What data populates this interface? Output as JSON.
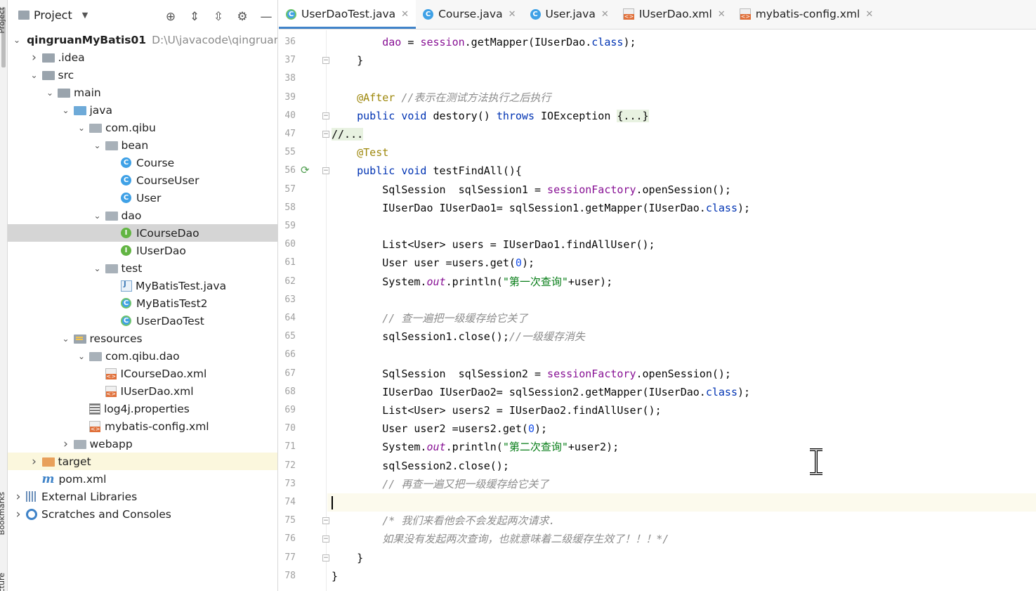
{
  "toolstrip": {
    "top_label": "Project",
    "bookmarks_label": "Bookmarks",
    "structure_label": "Structure"
  },
  "project_panel": {
    "title": "Project",
    "tree": [
      {
        "depth": 0,
        "arrow": "down",
        "icon": "module-folder",
        "label": "qingruanMyBatis01",
        "bold": true,
        "path": "D:\\U\\javacode\\qingruan"
      },
      {
        "depth": 1,
        "arrow": "right",
        "icon": "folder",
        "label": ".idea"
      },
      {
        "depth": 1,
        "arrow": "down",
        "icon": "folder",
        "label": "src"
      },
      {
        "depth": 2,
        "arrow": "down",
        "icon": "folder",
        "label": "main"
      },
      {
        "depth": 3,
        "arrow": "down",
        "icon": "folder-blue",
        "label": "java"
      },
      {
        "depth": 4,
        "arrow": "down",
        "icon": "package",
        "label": "com.qibu"
      },
      {
        "depth": 5,
        "arrow": "down",
        "icon": "package",
        "label": "bean"
      },
      {
        "depth": 6,
        "arrow": "none",
        "icon": "class",
        "label": "Course"
      },
      {
        "depth": 6,
        "arrow": "none",
        "icon": "class",
        "label": "CourseUser"
      },
      {
        "depth": 6,
        "arrow": "none",
        "icon": "class",
        "label": "User"
      },
      {
        "depth": 5,
        "arrow": "down",
        "icon": "package",
        "label": "dao"
      },
      {
        "depth": 6,
        "arrow": "none",
        "icon": "interface",
        "label": "ICourseDao",
        "selected": true
      },
      {
        "depth": 6,
        "arrow": "none",
        "icon": "interface",
        "label": "IUserDao"
      },
      {
        "depth": 5,
        "arrow": "down",
        "icon": "package",
        "label": "test"
      },
      {
        "depth": 6,
        "arrow": "none",
        "icon": "java-file",
        "label": "MyBatisTest.java"
      },
      {
        "depth": 6,
        "arrow": "none",
        "icon": "test-class",
        "label": "MyBatisTest2"
      },
      {
        "depth": 6,
        "arrow": "none",
        "icon": "test-class",
        "label": "UserDaoTest"
      },
      {
        "depth": 3,
        "arrow": "down",
        "icon": "resources-folder",
        "label": "resources"
      },
      {
        "depth": 4,
        "arrow": "down",
        "icon": "package",
        "label": "com.qibu.dao"
      },
      {
        "depth": 5,
        "arrow": "none",
        "icon": "xml",
        "label": "ICourseDao.xml"
      },
      {
        "depth": 5,
        "arrow": "none",
        "icon": "xml",
        "label": "IUserDao.xml"
      },
      {
        "depth": 4,
        "arrow": "none",
        "icon": "properties",
        "label": "log4j.properties"
      },
      {
        "depth": 4,
        "arrow": "none",
        "icon": "xml",
        "label": "mybatis-config.xml"
      },
      {
        "depth": 3,
        "arrow": "right",
        "icon": "webapp-folder",
        "label": "webapp"
      },
      {
        "depth": 1,
        "arrow": "right",
        "icon": "folder-orange",
        "label": "target",
        "excluded": true
      },
      {
        "depth": 1,
        "arrow": "none",
        "icon": "maven",
        "label": "pom.xml"
      },
      {
        "depth": 0,
        "arrow": "right",
        "icon": "libraries",
        "label": "External Libraries"
      },
      {
        "depth": 0,
        "arrow": "right",
        "icon": "scratches",
        "label": "Scratches and Consoles"
      }
    ]
  },
  "editor": {
    "tabs": [
      {
        "label": "UserDaoTest.java",
        "icon": "test-class",
        "active": true
      },
      {
        "label": "Course.java",
        "icon": "class",
        "active": false
      },
      {
        "label": "User.java",
        "icon": "class",
        "active": false
      },
      {
        "label": "IUserDao.xml",
        "icon": "xml",
        "active": false
      },
      {
        "label": "mybatis-config.xml",
        "icon": "xml",
        "active": false
      }
    ],
    "lines": [
      {
        "no": "36",
        "fold": false,
        "segments": [
          [
            "",
            "        "
          ],
          [
            "fld",
            "dao"
          ],
          [
            "",
            " = "
          ],
          [
            "fld",
            "session"
          ],
          [
            "",
            ".getMapper(IUserDao."
          ],
          [
            "kw",
            "class"
          ],
          [
            "",
            ");"
          ]
        ]
      },
      {
        "no": "37",
        "fold": true,
        "segments": [
          [
            "",
            "    }"
          ]
        ]
      },
      {
        "no": "38",
        "fold": false,
        "segments": []
      },
      {
        "no": "39",
        "fold": false,
        "segments": [
          [
            "",
            "    "
          ],
          [
            "ann",
            "@After"
          ],
          [
            "",
            " "
          ],
          [
            "cmt",
            "//表示在测试方法执行之后执行"
          ]
        ]
      },
      {
        "no": "40",
        "fold": true,
        "segments": [
          [
            "",
            "    "
          ],
          [
            "kw",
            "public"
          ],
          [
            "",
            " "
          ],
          [
            "kw",
            "void"
          ],
          [
            "",
            " "
          ],
          [
            "",
            "destory"
          ],
          [
            "",
            "() "
          ],
          [
            "kw",
            "throws"
          ],
          [
            "",
            " IOException "
          ],
          [
            "folded",
            "{...}"
          ]
        ]
      },
      {
        "no": "47",
        "fold": true,
        "segments": [
          [
            "folded",
            "//..."
          ]
        ]
      },
      {
        "no": "55",
        "fold": false,
        "segments": [
          [
            "",
            "    "
          ],
          [
            "ann",
            "@Test"
          ]
        ]
      },
      {
        "no": "56",
        "fold": true,
        "run": true,
        "segments": [
          [
            "",
            "    "
          ],
          [
            "kw",
            "public"
          ],
          [
            "",
            " "
          ],
          [
            "kw",
            "void"
          ],
          [
            "",
            " testFindAll(){"
          ]
        ]
      },
      {
        "no": "57",
        "fold": false,
        "segments": [
          [
            "",
            "        SqlSession  sqlSession1 = "
          ],
          [
            "fld",
            "sessionFactory"
          ],
          [
            "",
            ".openSession();"
          ]
        ]
      },
      {
        "no": "58",
        "fold": false,
        "segments": [
          [
            "",
            "        IUserDao IUserDao1= sqlSession1.getMapper(IUserDao."
          ],
          [
            "kw",
            "class"
          ],
          [
            "",
            ");"
          ]
        ]
      },
      {
        "no": "59",
        "fold": false,
        "segments": []
      },
      {
        "no": "60",
        "fold": false,
        "segments": [
          [
            "",
            "        List<User> users = IUserDao1.findAllUser();"
          ]
        ]
      },
      {
        "no": "61",
        "fold": false,
        "segments": [
          [
            "",
            "        User user =users.get("
          ],
          [
            "num",
            "0"
          ],
          [
            "",
            ");"
          ]
        ]
      },
      {
        "no": "62",
        "fold": false,
        "segments": [
          [
            "",
            "        System."
          ],
          [
            "stat",
            "out"
          ],
          [
            "",
            ".println("
          ],
          [
            "str",
            "\"第一次查询\""
          ],
          [
            "",
            "+user);"
          ]
        ]
      },
      {
        "no": "63",
        "fold": false,
        "segments": []
      },
      {
        "no": "64",
        "fold": false,
        "segments": [
          [
            "",
            "        "
          ],
          [
            "cmt",
            "// 查一遍把一级缓存给它关了"
          ]
        ]
      },
      {
        "no": "65",
        "fold": false,
        "segments": [
          [
            "",
            "        sqlSession1.close();"
          ],
          [
            "cmt",
            "//一级缓存消失"
          ]
        ]
      },
      {
        "no": "66",
        "fold": false,
        "segments": []
      },
      {
        "no": "67",
        "fold": false,
        "segments": [
          [
            "",
            "        SqlSession  sqlSession2 = "
          ],
          [
            "fld",
            "sessionFactory"
          ],
          [
            "",
            ".openSession();"
          ]
        ]
      },
      {
        "no": "68",
        "fold": false,
        "segments": [
          [
            "",
            "        IUserDao IUserDao2= sqlSession2.getMapper(IUserDao."
          ],
          [
            "kw",
            "class"
          ],
          [
            "",
            ");"
          ]
        ]
      },
      {
        "no": "69",
        "fold": false,
        "segments": [
          [
            "",
            "        List<User> users2 = IUserDao2.findAllUser();"
          ]
        ]
      },
      {
        "no": "70",
        "fold": false,
        "segments": [
          [
            "",
            "        User user2 =users2.get("
          ],
          [
            "num",
            "0"
          ],
          [
            "",
            ");"
          ]
        ]
      },
      {
        "no": "71",
        "fold": false,
        "segments": [
          [
            "",
            "        System."
          ],
          [
            "stat",
            "out"
          ],
          [
            "",
            ".println("
          ],
          [
            "str",
            "\"第二次查询\""
          ],
          [
            "",
            "+user2);"
          ]
        ]
      },
      {
        "no": "72",
        "fold": false,
        "segments": [
          [
            "",
            "        sqlSession2.close();"
          ]
        ]
      },
      {
        "no": "73",
        "fold": false,
        "segments": [
          [
            "",
            "        "
          ],
          [
            "cmt",
            "// 再查一遍又把一级缓存给它关了"
          ]
        ]
      },
      {
        "no": "74",
        "fold": false,
        "current": true,
        "segments": [
          [
            "caret",
            ""
          ]
        ]
      },
      {
        "no": "75",
        "fold": true,
        "segments": [
          [
            "",
            "        "
          ],
          [
            "cmt",
            "/* 我们来看他会不会发起两次请求."
          ]
        ]
      },
      {
        "no": "76",
        "fold": true,
        "segments": [
          [
            "",
            "        "
          ],
          [
            "cmt",
            "如果没有发起两次查询，也就意味着二级缓存生效了！！！*/"
          ]
        ]
      },
      {
        "no": "77",
        "fold": true,
        "segments": [
          [
            "",
            "    }"
          ]
        ]
      },
      {
        "no": "78",
        "fold": false,
        "segments": [
          [
            "",
            "}"
          ]
        ]
      }
    ]
  }
}
